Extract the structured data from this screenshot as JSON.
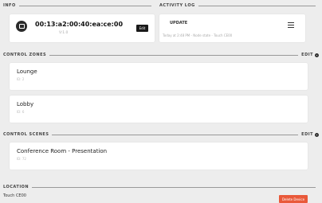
{
  "info": {
    "section_label": "INFO",
    "mac_address": "00:13:a2:00:40:ea:ce:00",
    "version": "V:1.0",
    "edit_label": "Edit"
  },
  "activity_log": {
    "section_label": "ACTIVITY LOG",
    "title": "UPDATE",
    "detail": "Today at 2:48 PM - Node state - Touch CE00"
  },
  "control_zones": {
    "section_label": "CONTROL ZONES",
    "edit_label": "EDIT",
    "items": [
      {
        "name": "Lounge",
        "id": "ID: 2"
      },
      {
        "name": "Lobby",
        "id": "ID: 6"
      }
    ]
  },
  "control_scenes": {
    "section_label": "CONTROL SCENES",
    "edit_label": "EDIT",
    "items": [
      {
        "name": "Conference Room - Presentation",
        "id": "ID: 72"
      }
    ]
  },
  "location": {
    "section_label": "LOCATION",
    "value": "Touch CE00",
    "delete_label": "Delete Device"
  }
}
